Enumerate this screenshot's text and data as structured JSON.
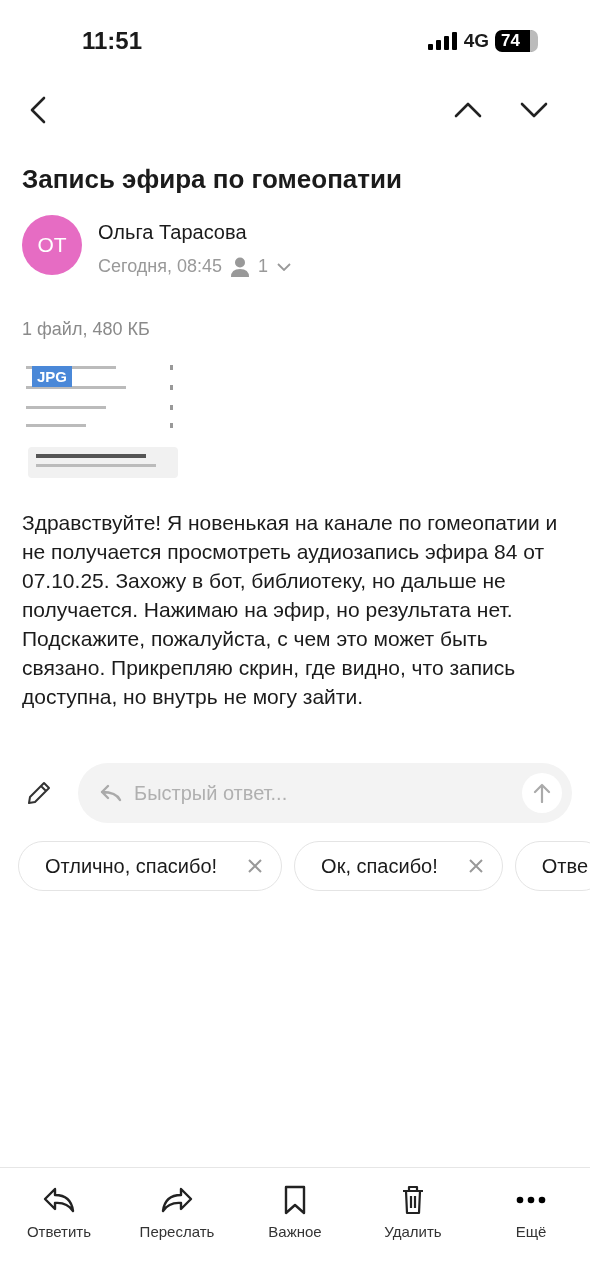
{
  "status_bar": {
    "time": "11:51",
    "network": "4G",
    "battery": "74"
  },
  "message": {
    "subject": "Запись эфира по гомеопатии",
    "avatar_initials": "ОТ",
    "sender": "Ольга Тарасова",
    "date": "Сегодня, 08:45",
    "recipients_count": "1"
  },
  "attachments": {
    "summary": "1 файл, 480 КБ",
    "items": [
      {
        "kind": "picture",
        "type": "JPG"
      }
    ]
  },
  "body": "Здравствуйте! Я новенькая на канале по гомеопатии и не получается просмотреть аудиозапись эфира 84 от 07.10.25. Захожу в бот, библиотеку, но дальше не получается. Нажимаю на эфир, но результата нет. Подскажите, пожалуйста, с чем это может быть связано. Прикрепляю скрин, где видно, что запись доступна, но внутрь не могу зайти.",
  "quick_reply": {
    "placeholder": "Быстрый ответ..."
  },
  "suggestions": [
    {
      "label": "Отлично, спасибо!",
      "closable": true
    },
    {
      "label": "Ок, спасибо!",
      "closable": true
    },
    {
      "label": "Отве",
      "closable": false
    }
  ],
  "toolbar": [
    {
      "kind": "reply",
      "label": "Ответить"
    },
    {
      "kind": "forward",
      "label": "Переслать"
    },
    {
      "kind": "important",
      "label": "Важное"
    },
    {
      "kind": "delete",
      "label": "Удалить"
    },
    {
      "kind": "more",
      "label": "Ещё"
    }
  ]
}
